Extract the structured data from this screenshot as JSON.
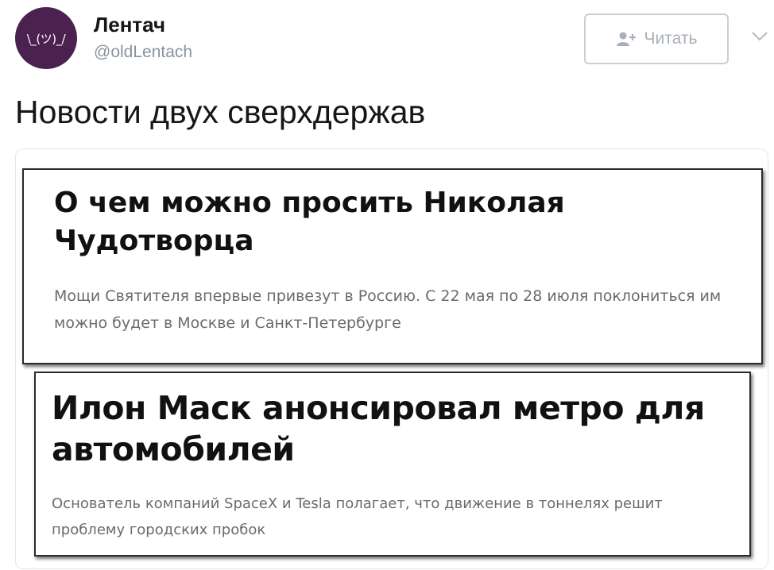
{
  "header": {
    "avatar_text": "\\_(ツ)_/",
    "display_name": "Лентач",
    "handle": "@oldLentach",
    "follow_label": "Читать",
    "follow_icon": "add-user-icon",
    "menu_icon": "chevron-down-icon"
  },
  "tweet": {
    "text": "Новости двух сверхдержав"
  },
  "cards": [
    {
      "title": "О чем можно просить Николая Чудотворца",
      "description": "Мощи Святителя впервые привезут в Россию. С 22 мая по 28 июля поклониться им можно будет в Москве и Санкт-Петербурге"
    },
    {
      "title": "Илон Маск анонсировал метро для автомобилей",
      "description": "Основатель компаний SpaceX и Tesla полагает, что движение в тоннелях решит проблему городских пробок"
    }
  ],
  "colors": {
    "avatar_bg": "#4b2150",
    "follow_text": "#a9b0b7",
    "handle": "#8a939c"
  }
}
